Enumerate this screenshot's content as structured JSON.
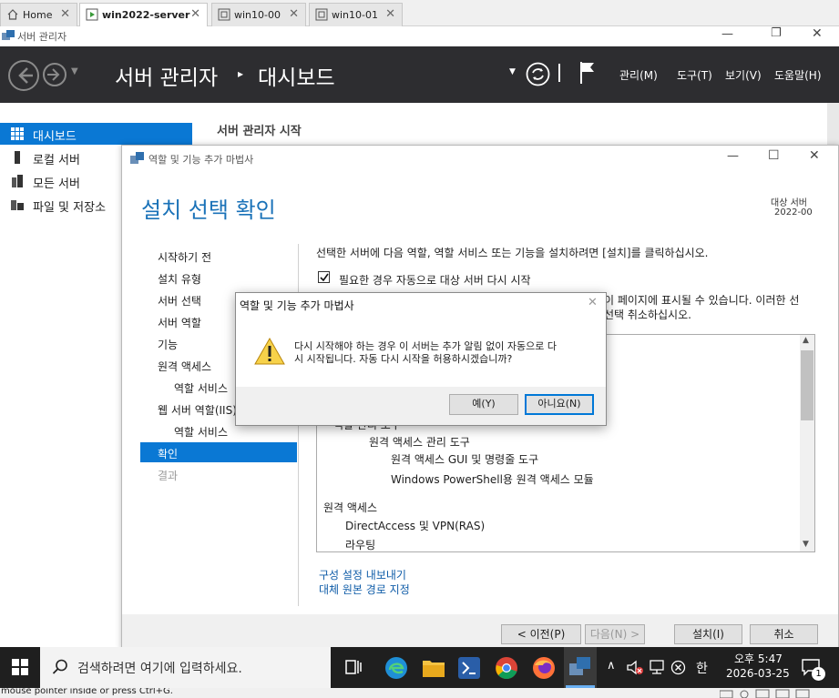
{
  "tabs": [
    {
      "label": "Home",
      "icon": "home-icon"
    },
    {
      "label": "win2022-server",
      "icon": "vm-icon"
    },
    {
      "label": "win10-00",
      "icon": "vm-icon"
    },
    {
      "label": "win10-01",
      "icon": "vm-icon"
    }
  ],
  "tab_close": "✕",
  "window": {
    "title": "서버 관리자"
  },
  "header": {
    "title": "서버 관리자",
    "sep": "▸",
    "page": "대시보드",
    "menu": [
      "관리(M)",
      "도구(T)",
      "보기(V)",
      "도움말(H)"
    ]
  },
  "sidebar": {
    "items": [
      {
        "label": "대시보드"
      },
      {
        "label": "로컬 서버"
      },
      {
        "label": "모든 서버"
      },
      {
        "label": "파일 및 저장소"
      }
    ]
  },
  "dashboard": {
    "start_title": "서버 관리자 시작"
  },
  "wizard": {
    "title": "역할 및 기능 추가 마법사",
    "heading": "설치 선택 확인",
    "target_label": "대상 서버",
    "target_value": "2022-00",
    "steps": [
      {
        "label": "시작하기 전"
      },
      {
        "label": "설치 유형"
      },
      {
        "label": "서버 선택"
      },
      {
        "label": "서버 역할"
      },
      {
        "label": "기능"
      },
      {
        "label": "원격 액세스"
      },
      {
        "label": "역할 서비스"
      },
      {
        "label": "웹 서버 역할(IIS)"
      },
      {
        "label": "역할 서비스"
      },
      {
        "label": "확인"
      },
      {
        "label": "결과"
      }
    ],
    "intro": "선택한 서버에 다음 역할, 역할 서비스 또는 기능을 설치하려면 [설치]를 클릭하십시오.",
    "restart_checkbox": "필요한 경우 자동으로 대상 서버 다시 시작",
    "restart_checked": true,
    "info_line1": "이 페이지에 표시될 수 있습니다. 이러한 선",
    "info_line2": "선택 취소하십시오.",
    "partial_item": "역할 관리 도구",
    "features": [
      {
        "label": "원격 액세스 관리 도구",
        "level": 2
      },
      {
        "label": "원격 액세스 GUI 및 명령줄 도구",
        "level": 3
      },
      {
        "label": "Windows PowerShell용 원격 액세스 모듈",
        "level": 3
      },
      {
        "label": "원격 액세스",
        "level": 0
      },
      {
        "label": "DirectAccess 및 VPN(RAS)",
        "level": 1
      },
      {
        "label": "라우팅",
        "level": 1
      }
    ],
    "link_export": "구성 설정 내보내기",
    "link_alt_source": "대체 원본 경로 지정",
    "buttons": {
      "prev": "< 이전(P)",
      "next": "다음(N) >",
      "install": "설치(I)",
      "cancel": "취소"
    }
  },
  "dialog": {
    "title": "역할 및 기능 추가 마법사",
    "message_line1": "다시 시작해야 하는 경우 이 서버는 추가 알림 없이 자동으로 다",
    "message_line2": "시 시작됩니다. 자동 다시 시작을 허용하시겠습니까?",
    "yes": "예(Y)",
    "no": "아니요(N)"
  },
  "taskbar": {
    "search_placeholder": "검색하려면 여기에 입력하세요.",
    "ime": "한",
    "time": "오후 5:47",
    "date": "2026-03-25",
    "notification_count": "1"
  },
  "statusbar": {
    "text": "mouse pointer inside or press Ctrl+G."
  },
  "colors": {
    "accent": "#0a78d4",
    "header_bg": "#2d2d30",
    "link": "#0f5ca8",
    "taskbar": "#1f1f1f"
  }
}
